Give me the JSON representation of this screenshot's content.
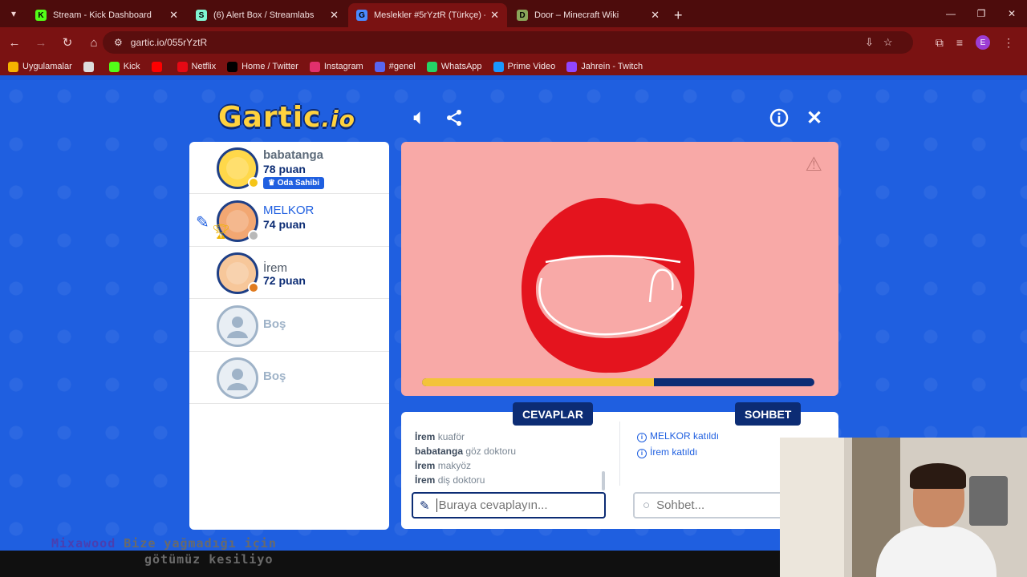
{
  "browser": {
    "tabs": [
      {
        "title": "Stream - Kick Dashboard",
        "fav": "K",
        "favcolor": "#53fc18",
        "active": false
      },
      {
        "title": "(6) Alert Box / Streamlabs",
        "fav": "S",
        "favcolor": "#80f5d2",
        "active": false
      },
      {
        "title": "Meslekler #5rYztR (Türkçe) - Ga",
        "fav": "G",
        "favcolor": "#4a8bff",
        "active": true
      },
      {
        "title": "Door – Minecraft Wiki",
        "fav": "D",
        "favcolor": "#8aa65a",
        "active": false
      }
    ],
    "url": "gartic.io/055rYztR",
    "profile_initial": "E",
    "bookmarks": [
      {
        "label": "Uygulamalar",
        "icon": "apps-icon",
        "color": "#f5b400"
      },
      {
        "label": "",
        "icon": "grid-icon",
        "color": "#dddddd"
      },
      {
        "label": "Kick",
        "icon": "kick-icon",
        "color": "#53fc18"
      },
      {
        "label": "",
        "icon": "youtube-icon",
        "color": "#ff0000"
      },
      {
        "label": "Netflix",
        "icon": "netflix-icon",
        "color": "#e50914"
      },
      {
        "label": "Home / Twitter",
        "icon": "x-icon",
        "color": "#000000"
      },
      {
        "label": "Instagram",
        "icon": "instagram-icon",
        "color": "#e1306c"
      },
      {
        "label": "#genel",
        "icon": "discord-icon",
        "color": "#5865f2"
      },
      {
        "label": "WhatsApp",
        "icon": "whatsapp-icon",
        "color": "#25d366"
      },
      {
        "label": "Prime Video",
        "icon": "prime-icon",
        "color": "#1a98ff"
      },
      {
        "label": "Jahrein - Twitch",
        "icon": "twitch-icon",
        "color": "#9146ff"
      }
    ]
  },
  "game": {
    "logo_main": "Gartic",
    "logo_suffix": ".io",
    "players": [
      {
        "name": "babatanga",
        "score": "78 puan",
        "badge": "Oda Sahibi",
        "state": "host",
        "dot": "#f5c518",
        "face": "#ffd84a"
      },
      {
        "name": "MELKOR",
        "score": "74 puan",
        "badge": "",
        "state": "drawer",
        "dot": "#b8b8b8",
        "face": "#f2a772"
      },
      {
        "name": "İrem",
        "score": "72 puan",
        "badge": "",
        "state": "plain",
        "dot": "#e07b1f",
        "face": "#f7c79a"
      },
      {
        "name": "Boş",
        "score": "",
        "badge": "",
        "state": "empty"
      },
      {
        "name": "Boş",
        "score": "",
        "badge": "",
        "state": "empty"
      }
    ],
    "timer_progress": 0.59,
    "answers_tab": "CEVAPLAR",
    "chat_tab": "SOHBET",
    "answers": [
      {
        "user": "İrem",
        "text": "kuaför"
      },
      {
        "user": "babatanga",
        "text": "göz doktoru"
      },
      {
        "user": "İrem",
        "text": "makyöz"
      },
      {
        "user": "İrem",
        "text": "diş doktoru"
      }
    ],
    "chat": [
      {
        "user": "MELKOR",
        "text": "katıldı"
      },
      {
        "user": "İrem",
        "text": "katıldı"
      }
    ],
    "answer_placeholder": "Buraya cevaplayın...",
    "chat_placeholder": "Sohbet..."
  },
  "overlay": {
    "caption_prefix": "Mixawood",
    "caption_line1": "Bize yağmadığı için",
    "caption_line2": "götümüz kesiliyo"
  },
  "colors": {
    "accent": "#1f5fe0",
    "navy": "#0c2c74",
    "canvas": "#f8a9a7",
    "lip_red": "#e4141e",
    "progress": "#f3c33a"
  }
}
